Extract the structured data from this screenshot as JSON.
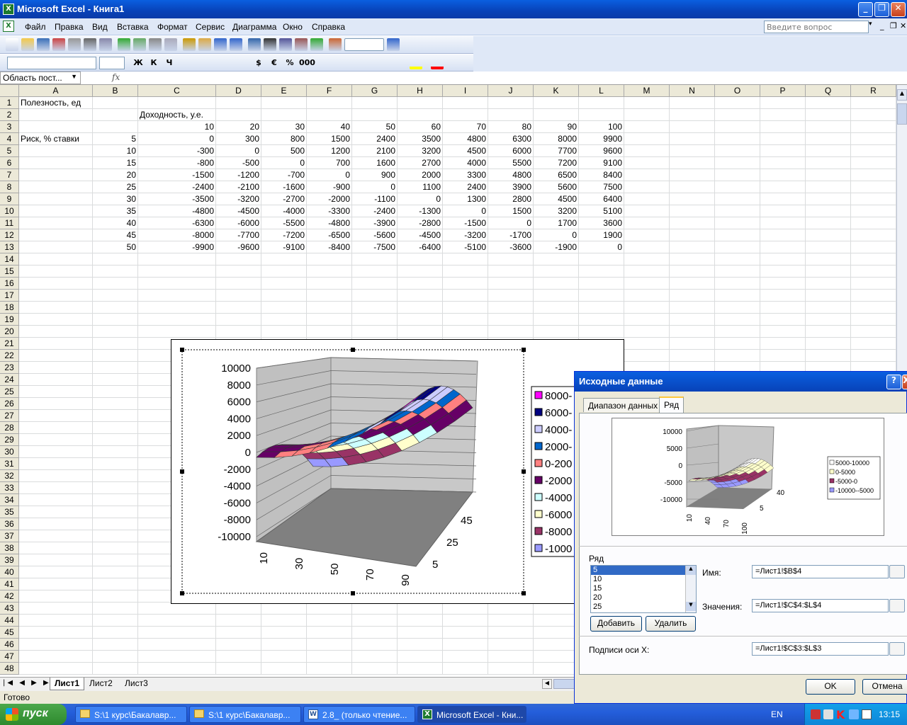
{
  "window": {
    "title": "Microsoft Excel - Книга1",
    "icon": "excel-icon"
  },
  "menu": {
    "items": [
      "Файл",
      "Правка",
      "Вид",
      "Вставка",
      "Формат",
      "Сервис",
      "Диаграмма",
      "Окно",
      "Справка"
    ],
    "ask_placeholder": "Введите вопрос"
  },
  "formula_bar": {
    "name_box": "Область пост...",
    "fx": "fx"
  },
  "columns": [
    "A",
    "B",
    "C",
    "D",
    "E",
    "F",
    "G",
    "H",
    "I",
    "J",
    "K",
    "L",
    "M",
    "N",
    "O",
    "P",
    "Q",
    "R"
  ],
  "cells": {
    "A1": "Полезность, ед",
    "C2": "Доходность, у.е.",
    "A4": "Риск, % ставки",
    "header_row": [
      "10",
      "20",
      "30",
      "40",
      "50",
      "60",
      "70",
      "80",
      "90",
      "100"
    ],
    "row_labels": [
      "5",
      "10",
      "15",
      "20",
      "25",
      "30",
      "35",
      "40",
      "45",
      "50"
    ],
    "matrix": [
      [
        "0",
        "300",
        "800",
        "1500",
        "2400",
        "3500",
        "4800",
        "6300",
        "8000",
        "9900"
      ],
      [
        "-300",
        "0",
        "500",
        "1200",
        "2100",
        "3200",
        "4500",
        "6000",
        "7700",
        "9600"
      ],
      [
        "-800",
        "-500",
        "0",
        "700",
        "1600",
        "2700",
        "4000",
        "5500",
        "7200",
        "9100"
      ],
      [
        "-1500",
        "-1200",
        "-700",
        "0",
        "900",
        "2000",
        "3300",
        "4800",
        "6500",
        "8400"
      ],
      [
        "-2400",
        "-2100",
        "-1600",
        "-900",
        "0",
        "1100",
        "2400",
        "3900",
        "5600",
        "7500"
      ],
      [
        "-3500",
        "-3200",
        "-2700",
        "-2000",
        "-1100",
        "0",
        "1300",
        "2800",
        "4500",
        "6400"
      ],
      [
        "-4800",
        "-4500",
        "-4000",
        "-3300",
        "-2400",
        "-1300",
        "0",
        "1500",
        "3200",
        "5100"
      ],
      [
        "-6300",
        "-6000",
        "-5500",
        "-4800",
        "-3900",
        "-2800",
        "-1500",
        "0",
        "1700",
        "3600"
      ],
      [
        "-8000",
        "-7700",
        "-7200",
        "-6500",
        "-5600",
        "-4500",
        "-3200",
        "-1700",
        "0",
        "1900"
      ],
      [
        "-9900",
        "-9600",
        "-9100",
        "-8400",
        "-7500",
        "-6400",
        "-5100",
        "-3600",
        "-1900",
        "0"
      ]
    ]
  },
  "chart_data": {
    "type": "surface",
    "categories": [
      "10",
      "20",
      "30",
      "40",
      "50",
      "60",
      "70",
      "80",
      "90",
      "100"
    ],
    "series_names": [
      "5",
      "10",
      "15",
      "20",
      "25",
      "30",
      "35",
      "40",
      "45",
      "50"
    ],
    "x_tick_labels": [
      "10",
      "30",
      "50",
      "70",
      "90"
    ],
    "depth_tick_labels": [
      "5",
      "25",
      "45"
    ],
    "z_tick_labels": [
      "10000",
      "8000",
      "6000",
      "4000",
      "2000",
      "0",
      "-2000",
      "-4000",
      "-6000",
      "-8000",
      "-10000"
    ],
    "zlim": [
      -10000,
      10000
    ],
    "legend": [
      {
        "label": "8000-",
        "color": "#ff00ff"
      },
      {
        "label": "6000-",
        "color": "#000080"
      },
      {
        "label": "4000-",
        "color": "#ccccff"
      },
      {
        "label": "2000-",
        "color": "#0066cc"
      },
      {
        "label": "0-200",
        "color": "#ff8080"
      },
      {
        "label": "-2000",
        "color": "#660066"
      },
      {
        "label": "-4000",
        "color": "#ccffff"
      },
      {
        "label": "-6000",
        "color": "#ffffcc"
      },
      {
        "label": "-8000",
        "color": "#993366"
      },
      {
        "label": "-1000",
        "color": "#9999ff"
      }
    ],
    "legend_position": "right"
  },
  "sheet_tabs": [
    "Лист1",
    "Лист2",
    "Лист3"
  ],
  "status": "Готово",
  "dialog": {
    "title": "Исходные данные",
    "tabs": [
      "Диапазон данных",
      "Ряд"
    ],
    "preview_z_ticks": [
      "10000",
      "5000",
      "0",
      "-5000",
      "-10000"
    ],
    "preview_x_ticks": [
      "10",
      "40",
      "70",
      "100"
    ],
    "preview_depth_ticks": [
      "5",
      "40"
    ],
    "preview_legend": [
      "5000-10000",
      "0-5000",
      "-5000-0",
      "-10000--5000"
    ],
    "preview_legend_colors": [
      "#ffffff",
      "#ffffcc",
      "#993366",
      "#9999ff"
    ],
    "series_group_label": "Ряд",
    "series_list": [
      "5",
      "10",
      "15",
      "20",
      "25"
    ],
    "name_label": "Имя:",
    "name_value": "=Лист1!$B$4",
    "values_label": "Значения:",
    "values_value": "=Лист1!$C$4:$L$4",
    "add_button": "Добавить",
    "remove_button": "Удалить",
    "xaxis_label": "Подписи оси X:",
    "xaxis_value": "=Лист1!$C$3:$L$3",
    "ok": "OK",
    "cancel": "Отмена",
    "help": "?",
    "close": "X"
  },
  "taskbar": {
    "start": "пуск",
    "tasks": [
      "S:\\1 курс\\Бакалавр...",
      "S:\\1 курс\\Бакалавр...",
      "2.8_ (только чтение...",
      "Microsoft Excel - Кни..."
    ],
    "lang": "EN",
    "clock": "13:15"
  }
}
